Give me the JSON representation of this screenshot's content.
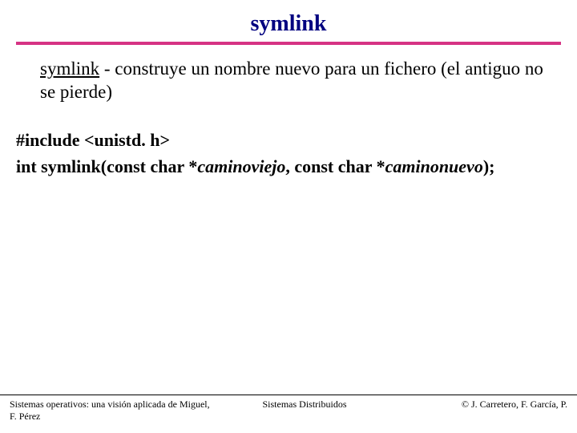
{
  "title": "symlink",
  "desc_fn": "symlink",
  "desc_rest": " - construye un nombre nuevo para un fichero (el antiguo no se pierde)",
  "code_line1": "#include <unistd. h>",
  "code_prefix": "int symlink(const char *",
  "code_arg1": "caminoviejo",
  "code_mid": ", const char *",
  "code_arg2": "caminonuevo",
  "code_suffix": ");",
  "footer": {
    "left": "Sistemas operativos: una visión aplicada de Miguel, F. Pérez",
    "mid": "Sistemas Distribuidos",
    "right": "© J. Carretero, F. García, P."
  }
}
